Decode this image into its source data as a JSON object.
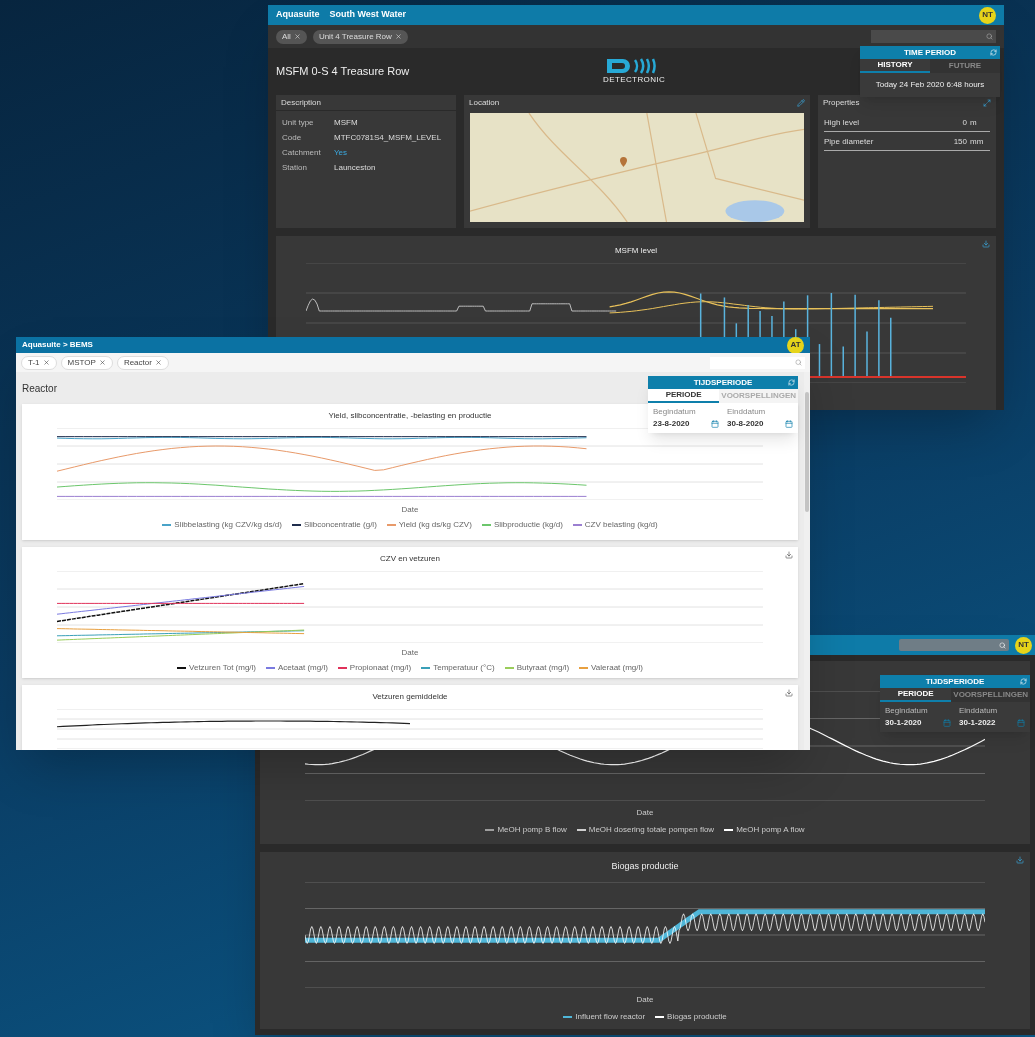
{
  "site_window": {
    "app_title": "Aquasuite",
    "org": "South West Water",
    "avatar": "NT",
    "chips": [
      "All",
      "Unit 4 Treasure Row"
    ],
    "page_title": "MSFM 0-S 4 Treasure Row",
    "logo_text": "DETECTRONIC",
    "period": {
      "title": "TIME PERIOD",
      "tabs": [
        {
          "label": "HISTORY",
          "selected": true
        },
        {
          "label": "FUTURE",
          "selected": false
        }
      ],
      "value": "Today 24 Feb 2020 6:48 hours"
    },
    "description": {
      "title": "Description",
      "rows": [
        {
          "label": "Unit type",
          "value": "MSFM",
          "kind": "text"
        },
        {
          "label": "Code",
          "value": "MTFC0781S4_MSFM_LEVEL",
          "kind": "text"
        },
        {
          "label": "Catchment",
          "value": "Yes",
          "kind": "link"
        },
        {
          "label": "Station",
          "value": "Launceston",
          "kind": "text"
        }
      ]
    },
    "location": {
      "title": "Location"
    },
    "properties": {
      "title": "Properties",
      "rows": [
        {
          "label": "High level",
          "value": "0",
          "unit": "m"
        },
        {
          "label": "Pipe diameter",
          "value": "150",
          "unit": "mm"
        }
      ]
    },
    "chart": {
      "title": "MSFM level"
    }
  },
  "reactor_window": {
    "breadcrumb": "Aquasuite > BEMS",
    "avatar": "AT",
    "chips": [
      "T-1",
      "MSTOP",
      "Reactor"
    ],
    "page_title": "Reactor",
    "period": {
      "title": "TIJDSPERIODE",
      "tabs": [
        {
          "label": "PERIODE",
          "selected": true
        },
        {
          "label": "VOORSPELLINGEN",
          "selected": false
        }
      ],
      "fields": [
        {
          "label": "Begindatum",
          "value": "23-8-2020"
        },
        {
          "label": "Einddatum",
          "value": "30-8-2020"
        }
      ]
    },
    "charts": [
      {
        "title": "Yield, slibconcentratie, -belasting en productie",
        "xlabel": "Date",
        "legend": [
          {
            "label": "Slibbelasting (kg CZV/kg ds/d)",
            "color": "#4aa3c8"
          },
          {
            "label": "Slibconcentratie (g/l)",
            "color": "#1f2d4d"
          },
          {
            "label": "Yield (kg ds/kg CZV)",
            "color": "#e89a6a"
          },
          {
            "label": "Slibproductie (kg/d)",
            "color": "#6cc66c"
          },
          {
            "label": "CZV belasting (kg/d)",
            "color": "#9b7fd1"
          }
        ]
      },
      {
        "title": "CZV en vetzuren",
        "xlabel": "Date",
        "legend": [
          {
            "label": "Vetzuren Tot (mg/l)",
            "color": "#111111"
          },
          {
            "label": "Acetaat (mg/l)",
            "color": "#7a7ae0"
          },
          {
            "label": "Propionaat (mg/l)",
            "color": "#e0325a"
          },
          {
            "label": "Temperatuur (°C)",
            "color": "#3aa0b8"
          },
          {
            "label": "Butyraat (mg/l)",
            "color": "#9acd5a"
          },
          {
            "label": "Valeraat (mg/l)",
            "color": "#e8a040"
          }
        ]
      },
      {
        "title": "Vetzuren gemiddelde"
      }
    ]
  },
  "biogas_window": {
    "avatar": "NT",
    "period": {
      "title": "TIJDSPERIODE",
      "tabs": [
        {
          "label": "PERIODE",
          "selected": true
        },
        {
          "label": "VOORSPELLINGEN",
          "selected": false
        }
      ],
      "fields": [
        {
          "label": "Begindatum",
          "value": "30-1-2020"
        },
        {
          "label": "Einddatum",
          "value": "30-1-2022"
        }
      ]
    },
    "charts": [
      {
        "xlabel": "Date",
        "legend": [
          {
            "label": "MeOH pomp B flow",
            "color": "#9e9e9e"
          },
          {
            "label": "MeOH dosering totale pompen flow",
            "color": "#cfcfcf"
          },
          {
            "label": "MeOH pomp A flow",
            "color": "#ffffff"
          }
        ]
      },
      {
        "title": "Biogas productie",
        "xlabel": "Date",
        "legend": [
          {
            "label": "Influent flow reactor",
            "color": "#4fb6d8"
          },
          {
            "label": "Biogas productie",
            "color": "#ffffff"
          }
        ]
      }
    ]
  }
}
